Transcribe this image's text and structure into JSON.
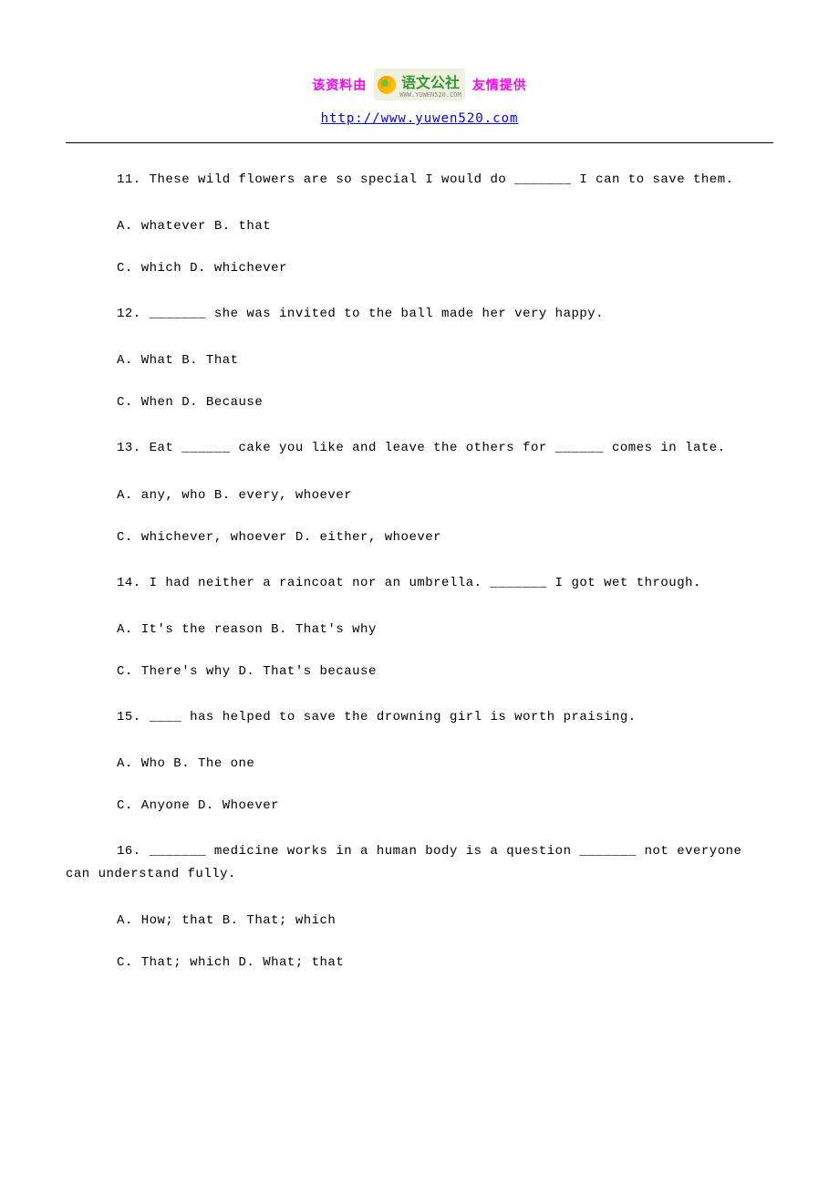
{
  "header": {
    "prefix": "该资料由",
    "logo_cn": "语文公社",
    "logo_en": "WWW.YUWEN520.COM",
    "suffix": "友情提供",
    "url": "http://www.yuwen520.com"
  },
  "questions": [
    {
      "text": "11. These wild flowers are so special I would do _______ I can to save them.",
      "opt1": "A. whatever B. that",
      "opt2": "C. which D. whichever"
    },
    {
      "text": "12. _______ she was invited to the ball made her very happy.",
      "opt1": "A. What B. That",
      "opt2": "C. When D. Because"
    },
    {
      "text": "13. Eat ______ cake you like and leave the others for ______ comes in late.",
      "opt1": "A. any, who B. every, whoever",
      "opt2": "C. whichever, whoever D. either, whoever"
    },
    {
      "text": "14. I had neither a raincoat nor an umbrella. _______ I got wet through.",
      "opt1": "A. It's the reason B. That's why",
      "opt2": "C. There's why D. That's because"
    },
    {
      "text": "15. ____ has helped to save the drowning girl is worth praising.",
      "opt1": "A. Who B. The one",
      "opt2": "C. Anyone D. Whoever"
    },
    {
      "text_line1": "16. _______ medicine works in a human body is a question _______ not everyone",
      "text_line2": "can understand fully.",
      "opt1": "A. How; that B. That; which",
      "opt2": "C. That; which D. What; that"
    }
  ]
}
